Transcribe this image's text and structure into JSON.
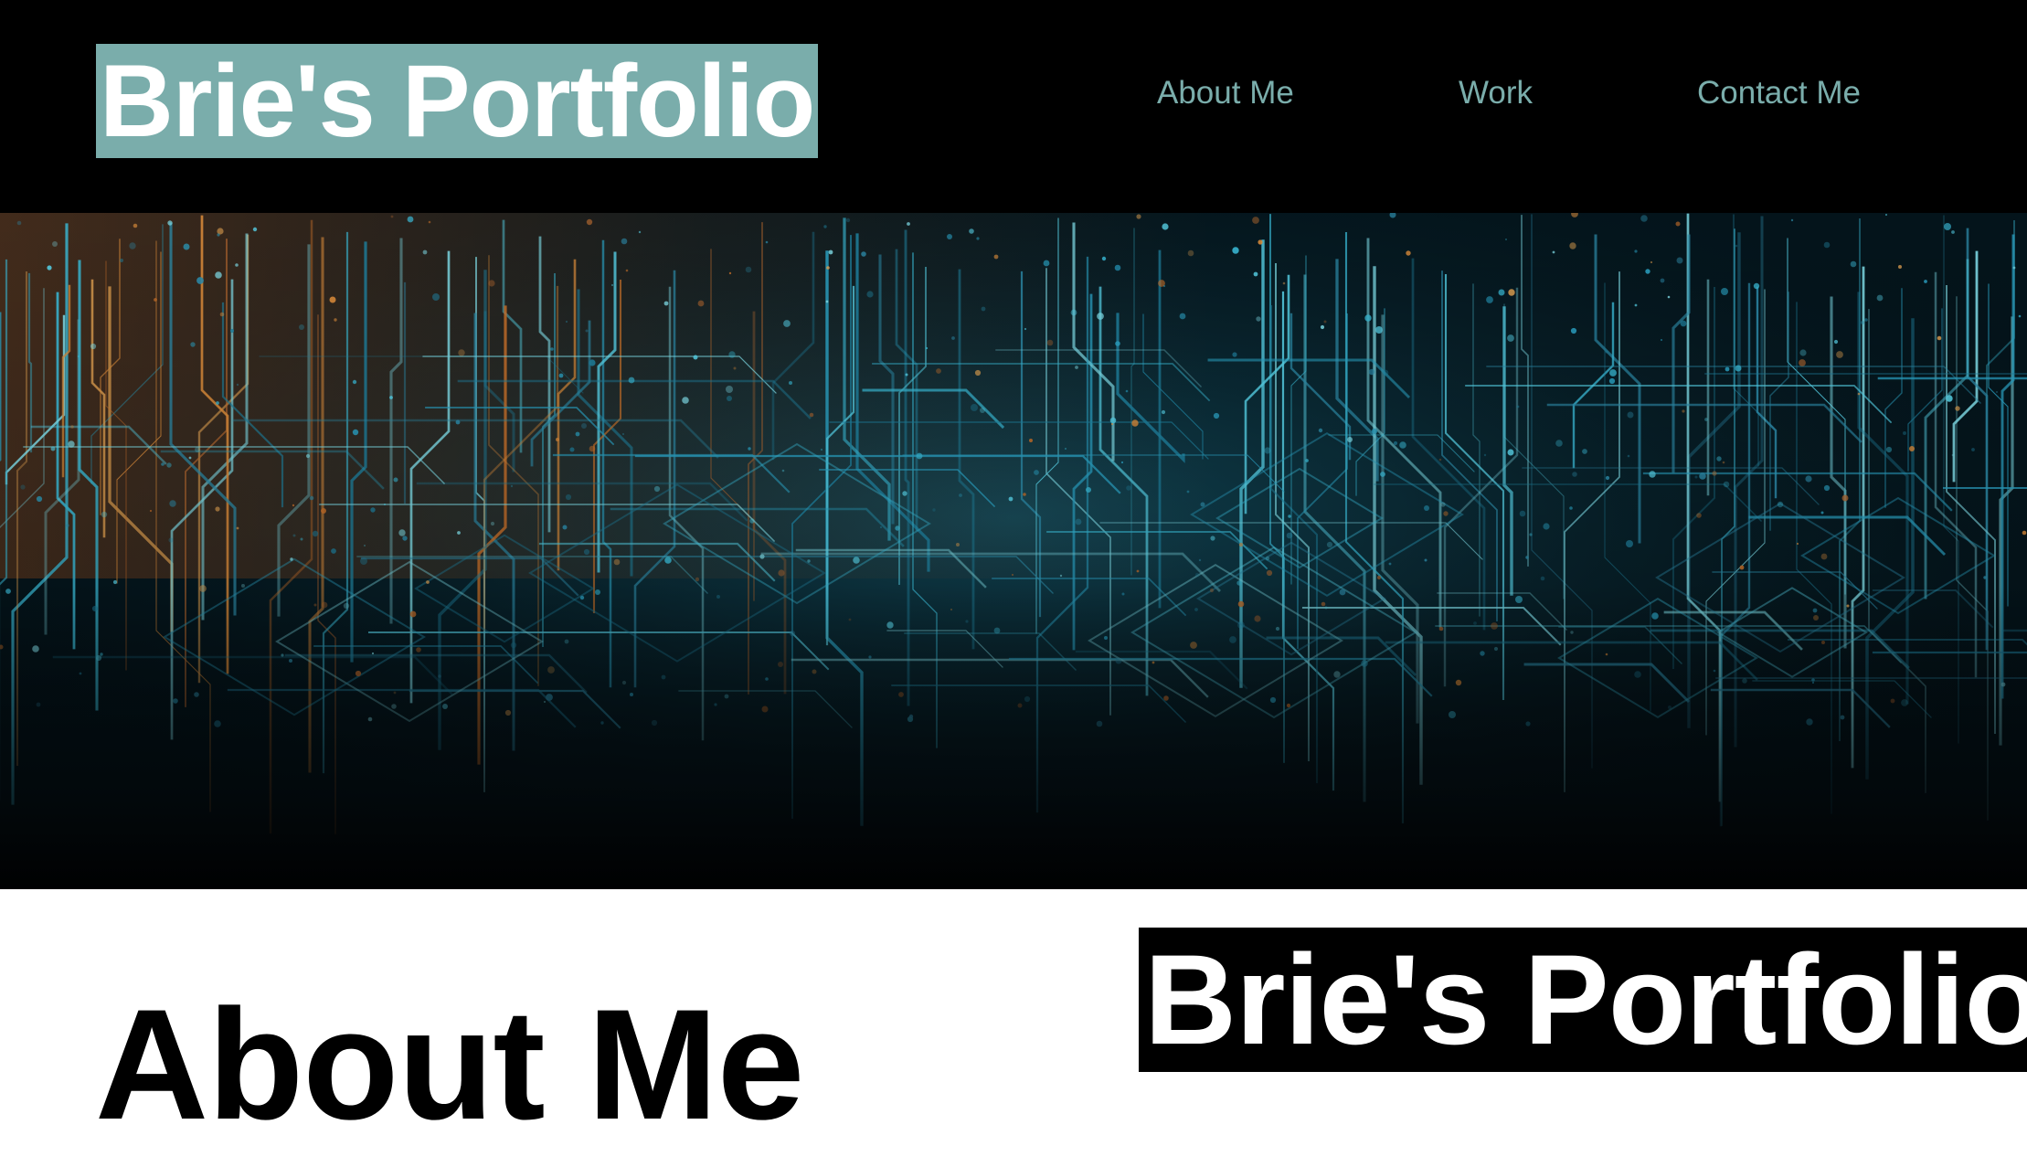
{
  "header": {
    "brand_title": "Brie's Portfolio",
    "nav": {
      "about": "About Me",
      "work": "Work",
      "contact": "Contact Me"
    }
  },
  "hero": {
    "image": "circuit-board-image"
  },
  "main": {
    "about_heading": "About Me",
    "brand_title_dark": "Brie's Portfolio"
  },
  "colors": {
    "header_bg": "#000000",
    "brand_bg": "#7aadab",
    "nav_text": "#7aadab",
    "page_bg": "#ffffff"
  }
}
